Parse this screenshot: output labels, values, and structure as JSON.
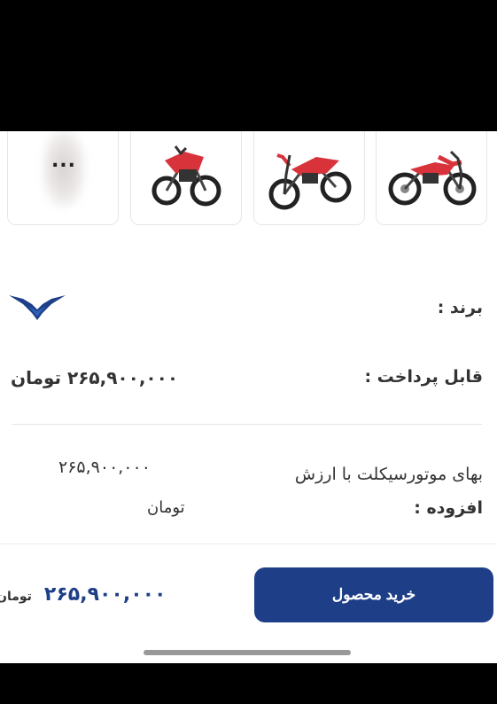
{
  "gallery": {
    "more_label": "...",
    "thumbnails": [
      "motorcycle-thumbnail",
      "motorcycle-thumbnail",
      "motorcycle-thumbnail",
      "blurred-more-thumbnail"
    ]
  },
  "details": {
    "brand_label": "برند :",
    "payable_label": "قابل پرداخت :",
    "payable_value": "۲۶۵,۹۰۰,۰۰۰ تومان",
    "vat_price_label_line1": "بهای موتورسیکلت با ارزش",
    "vat_price_label_line2": "افزوده :",
    "vat_price_amount": "۲۶۵,۹۰۰,۰۰۰",
    "vat_price_unit": "تومان"
  },
  "footer": {
    "buy_label": "خرید محصول",
    "price_amount": "۲۶۵,۹۰۰,۰۰۰",
    "price_unit": "تومان"
  },
  "colors": {
    "accent": "#1e3f87",
    "bike_red": "#d8333b"
  }
}
